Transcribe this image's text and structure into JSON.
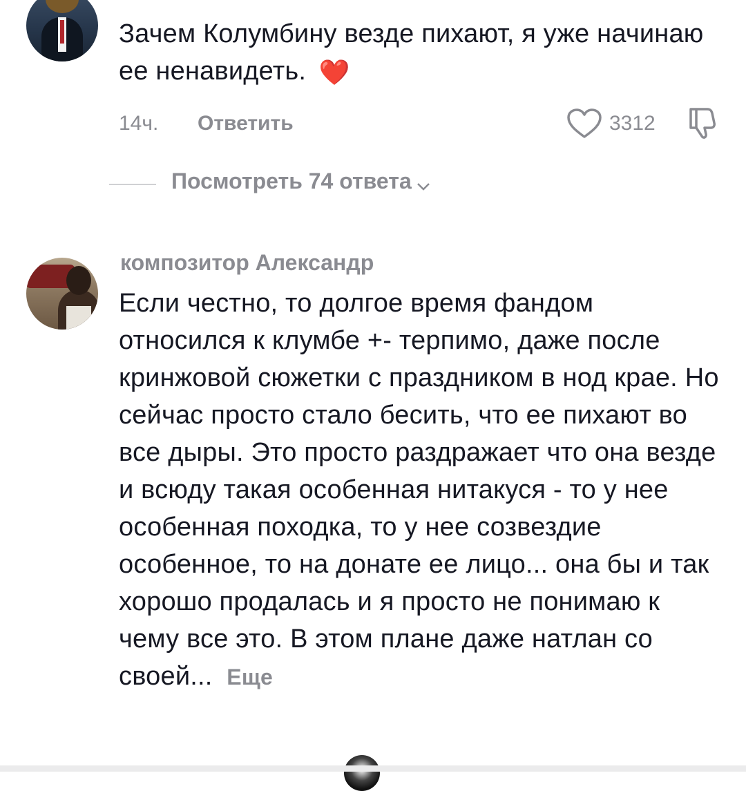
{
  "comments": [
    {
      "text": "Зачем Колумбину везде пихают, я уже начинаю ее ненавидеть.",
      "emoji": "❤️",
      "time": "14ч.",
      "reply_label": "Ответить",
      "likes": "3312",
      "view_replies": "Посмотреть 74 ответа"
    },
    {
      "username": "композитор Александр",
      "text": "Если честно, то долгое время фандом относился к клумбе +- терпимо, даже после кринжовой сюжетки с праздником в нод крае. Но сейчас просто стало бесить, что ее пихают во все дыры. Это просто раздражает что она везде и всюду такая особенная нитакуся - то у нее особенная походка, то у нее созвездие особенное, то на донате ее лицо... она бы и так хорошо продалась и я просто не понимаю к чему все это. В этом плане даже натлан со своей...",
      "more_label": "Еще"
    }
  ],
  "icons": {
    "like": "heart-outline-icon",
    "dislike": "thumbs-down-icon",
    "expand": "chevron-down-icon"
  },
  "colors": {
    "text": "#161823",
    "muted": "#8a8b91",
    "heart": "#e3242b"
  }
}
